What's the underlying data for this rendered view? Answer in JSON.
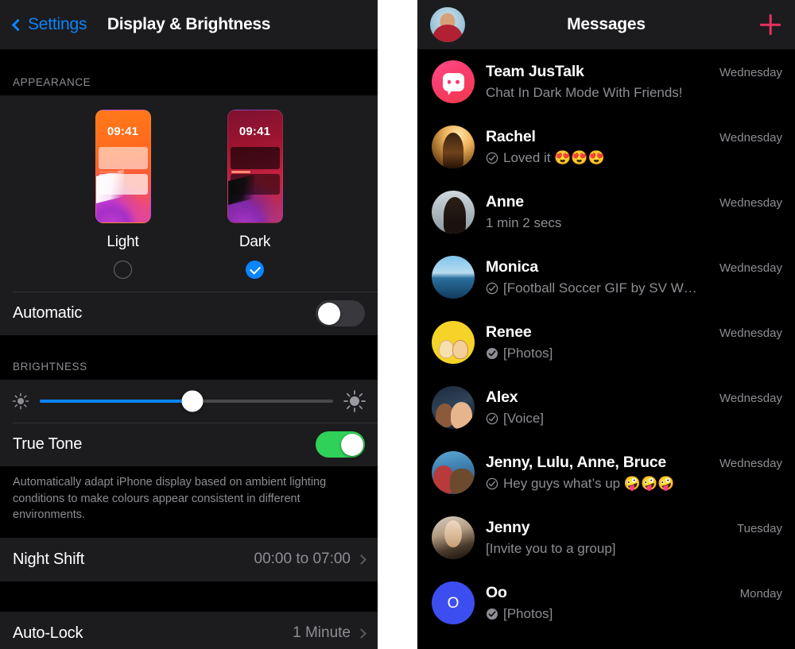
{
  "settings": {
    "back_label": "Settings",
    "title": "Display & Brightness",
    "appearance": {
      "header": "APPEARANCE",
      "light": {
        "label": "Light",
        "time": "09:41",
        "selected": false
      },
      "dark": {
        "label": "Dark",
        "time": "09:41",
        "selected": true
      },
      "automatic": {
        "label": "Automatic",
        "state": "off"
      }
    },
    "brightness": {
      "header": "BRIGHTNESS",
      "slider_percent": 52,
      "true_tone": {
        "label": "True Tone",
        "state": "on"
      },
      "true_tone_footnote": "Automatically adapt iPhone display based on ambient lighting conditions to make colours appear consistent in different environments."
    },
    "night_shift": {
      "label": "Night Shift",
      "value": "00:00 to 07:00"
    },
    "auto_lock": {
      "label": "Auto-Lock",
      "value": "1 Minute"
    },
    "accent_color": "#0a84ff",
    "toggle_on_color": "#30d158"
  },
  "messages": {
    "title": "Messages",
    "add_label": "+",
    "accent_color": "#e8315f",
    "conversations": [
      {
        "name": "Team JusTalk",
        "preview": "Chat In Dark Mode With Friends!",
        "time": "Wednesday",
        "tick": "none",
        "avatar": "justalk-logo"
      },
      {
        "name": "Rachel",
        "preview": "Loved it 😍😍😍",
        "time": "Wednesday",
        "tick": "outline",
        "avatar": "rachel-photo"
      },
      {
        "name": "Anne",
        "preview": "1 min 2 secs",
        "time": "Wednesday",
        "tick": "none",
        "avatar": "anne-photo"
      },
      {
        "name": "Monica",
        "preview": "[Football Soccer GIF by SV W…",
        "time": "Wednesday",
        "tick": "outline",
        "avatar": "monica-photo"
      },
      {
        "name": "Renee",
        "preview": "[Photos]",
        "time": "Wednesday",
        "tick": "filled",
        "avatar": "renee-photo"
      },
      {
        "name": "Alex",
        "preview": "[Voice]",
        "time": "Wednesday",
        "tick": "outline",
        "avatar": "alex-photo"
      },
      {
        "name": "Jenny, Lulu, Anne, Bruce",
        "preview": "Hey guys what’s up 🤪🤪🤪",
        "time": "Wednesday",
        "tick": "outline",
        "avatar": "group-photo"
      },
      {
        "name": "Jenny",
        "preview": "[Invite you to a group]",
        "time": "Tuesday",
        "tick": "none",
        "avatar": "jenny-photo"
      },
      {
        "name": "Oo",
        "preview": "[Photos]",
        "time": "Monday",
        "tick": "filled",
        "avatar": "oo-initial",
        "initial": "O"
      }
    ]
  }
}
